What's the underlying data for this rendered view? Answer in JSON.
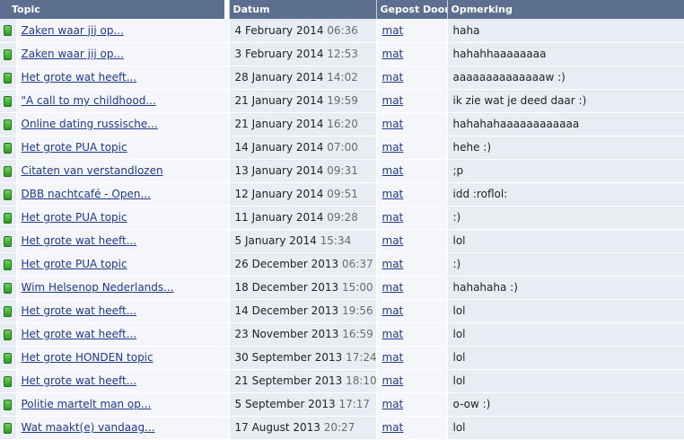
{
  "headers": {
    "topic": "Topic",
    "datum": "Datum",
    "gepost_door": "Gepost Door",
    "opmerking": "Opmerking"
  },
  "status_icon": "green-status-icon",
  "rows": [
    {
      "topic": "Zaken waar jij op...",
      "date": "4 February 2014",
      "time": "06:36",
      "user": "mat",
      "note": "haha"
    },
    {
      "topic": "Zaken waar jij op...",
      "date": "3 February 2014",
      "time": "12:53",
      "user": "mat",
      "note": "hahahhaaaaaaaa"
    },
    {
      "topic": "Het grote wat heeft...",
      "date": "28 January 2014",
      "time": "14:02",
      "user": "mat",
      "note": "aaaaaaaaaaaaaaw :)"
    },
    {
      "topic": "\"A call to my childhood...",
      "date": "21 January 2014",
      "time": "19:59",
      "user": "mat",
      "note": "ik zie wat je deed daar :)"
    },
    {
      "topic": "Online dating russische...",
      "date": "21 January 2014",
      "time": "16:20",
      "user": "mat",
      "note": "hahahahaaaaaaaaaaaa"
    },
    {
      "topic": "Het grote PUA topic",
      "date": "14 January 2014",
      "time": "07:00",
      "user": "mat",
      "note": "hehe :)"
    },
    {
      "topic": "Citaten van verstandlozen",
      "date": "13 January 2014",
      "time": "09:31",
      "user": "mat",
      "note": ";p"
    },
    {
      "topic": "DBB nachtcafé - Open...",
      "date": "12 January 2014",
      "time": "09:51",
      "user": "mat",
      "note": "idd :roflol:"
    },
    {
      "topic": "Het grote PUA topic",
      "date": "11 January 2014",
      "time": "09:28",
      "user": "mat",
      "note": ":)"
    },
    {
      "topic": "Het grote wat heeft...",
      "date": "5 January 2014",
      "time": "15:34",
      "user": "mat",
      "note": "lol"
    },
    {
      "topic": "Het grote PUA topic",
      "date": "26 December 2013",
      "time": "06:37",
      "user": "mat",
      "note": ":)"
    },
    {
      "topic": "Wim Helsenop Nederlands...",
      "date": "18 December 2013",
      "time": "15:00",
      "user": "mat",
      "note": "hahahaha :)"
    },
    {
      "topic": "Het grote wat heeft...",
      "date": "14 December 2013",
      "time": "19:56",
      "user": "mat",
      "note": "lol"
    },
    {
      "topic": "Het grote wat heeft...",
      "date": "23 November 2013",
      "time": "16:59",
      "user": "mat",
      "note": "lol"
    },
    {
      "topic": "Het grote HONDEN topic",
      "date": "30 September 2013",
      "time": "17:24",
      "user": "mat",
      "note": "lol"
    },
    {
      "topic": "Het grote wat heeft...",
      "date": "21 September 2013",
      "time": "18:10",
      "user": "mat",
      "note": "lol"
    },
    {
      "topic": "Politie martelt man op...",
      "date": "5 September 2013",
      "time": "17:17",
      "user": "mat",
      "note": "o-ow :)"
    },
    {
      "topic": "Wat maakt(e) vandaag...",
      "date": "17 August 2013",
      "time": "20:27",
      "user": "mat",
      "note": "lol"
    }
  ]
}
